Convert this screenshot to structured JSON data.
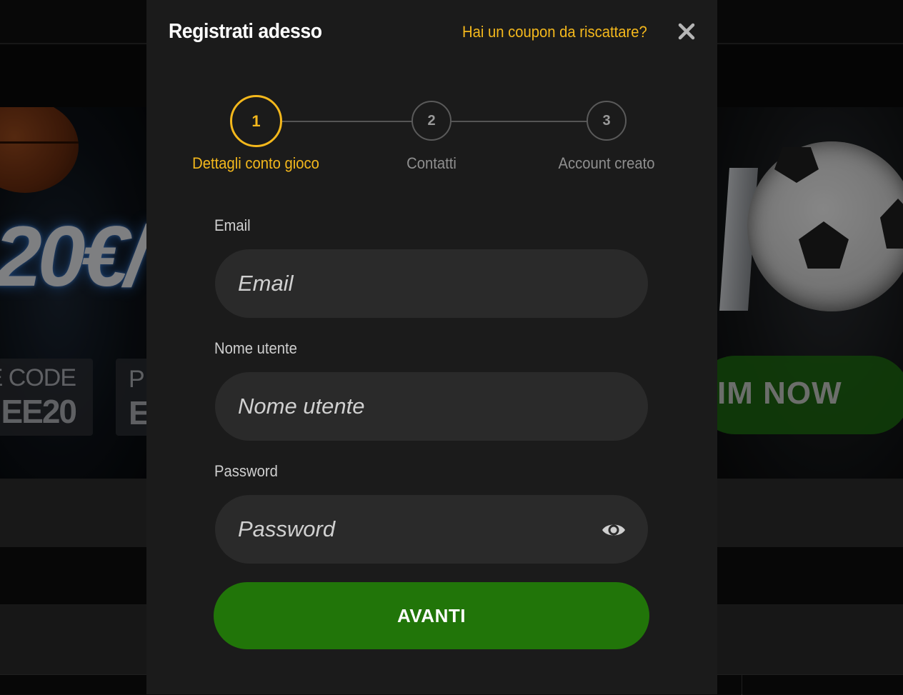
{
  "background": {
    "banner_left": {
      "amount_text": "20€/",
      "code_line1": "E CODE",
      "code_line2": "EE20",
      "code2_line1": "P",
      "code2_line2": "E"
    },
    "banner_right": {
      "cta_text": "IM NOW"
    }
  },
  "modal": {
    "title": "Registrati adesso",
    "coupon_link": "Hai un coupon da riscattare?",
    "close_icon": "close-icon"
  },
  "stepper": {
    "steps": [
      {
        "number": "1",
        "label": "Dettagli conto gioco",
        "active": true
      },
      {
        "number": "2",
        "label": "Contatti",
        "active": false
      },
      {
        "number": "3",
        "label": "Account creato",
        "active": false
      }
    ],
    "active_color": "#f4b81c"
  },
  "form": {
    "email": {
      "label": "Email",
      "placeholder": "Email",
      "value": ""
    },
    "username": {
      "label": "Nome utente",
      "placeholder": "Nome utente",
      "value": ""
    },
    "password": {
      "label": "Password",
      "placeholder": "Password",
      "value": "",
      "toggle_icon": "eye-icon"
    },
    "submit_label": "AVANTI",
    "submit_color": "#217509"
  }
}
